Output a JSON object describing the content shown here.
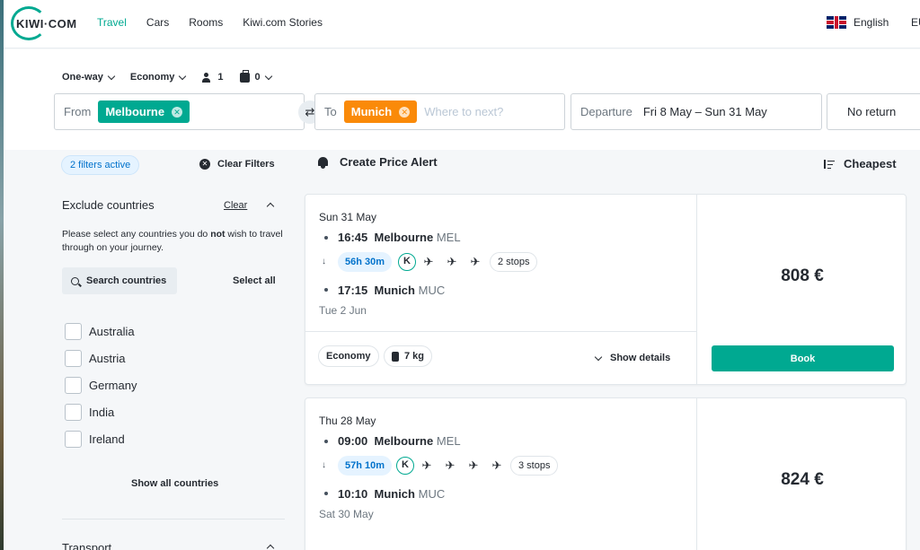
{
  "header": {
    "logo_text": "KIWI·COM",
    "nav": [
      "Travel",
      "Cars",
      "Rooms",
      "Kiwi.com Stories"
    ],
    "language": "English",
    "currency": "EU"
  },
  "search": {
    "trip_type": "One-way",
    "cabin": "Economy",
    "passengers": "1",
    "bags": "0",
    "from_label": "From",
    "from_value": "Melbourne",
    "to_label": "To",
    "to_value": "Munich",
    "to_placeholder": "Where to next?",
    "departure_label": "Departure",
    "departure_value": "Fri 8 May – Sun 31 May",
    "return_value": "No return"
  },
  "filters": {
    "badge": "2 filters active",
    "clear_filters": "Clear Filters",
    "exclude_title": "Exclude countries",
    "clear": "Clear",
    "help_text_before": "Please select any countries you do ",
    "help_text_bold": "not",
    "help_text_after": " wish to travel through on your journey.",
    "search_countries": "Search countries",
    "select_all": "Select all",
    "countries": [
      "Australia",
      "Austria",
      "Germany",
      "India",
      "Ireland"
    ],
    "show_all": "Show all countries",
    "transport": "Transport"
  },
  "results": {
    "create_alert": "Create Price Alert",
    "sort": "Cheapest",
    "cards": [
      {
        "depart_date": "Sun 31 May",
        "depart_time": "16:45",
        "depart_city": "Melbourne",
        "depart_code": "MEL",
        "duration": "56h 30m",
        "stops": "2 stops",
        "planes": 3,
        "arrive_time": "17:15",
        "arrive_city": "Munich",
        "arrive_code": "MUC",
        "arrive_date": "Tue 2 Jun",
        "cabin": "Economy",
        "baggage": "7 kg",
        "show_details": "Show details",
        "price": "808 €",
        "book": "Book"
      },
      {
        "depart_date": "Thu 28 May",
        "depart_time": "09:00",
        "depart_city": "Melbourne",
        "depart_code": "MEL",
        "duration": "57h 10m",
        "stops": "3 stops",
        "planes": 4,
        "arrive_time": "10:10",
        "arrive_city": "Munich",
        "arrive_code": "MUC",
        "arrive_date": "Sat 30 May",
        "price": "824 €"
      }
    ]
  },
  "icons": {
    "plane": "✈",
    "swap": "⇄",
    "close": "✕"
  },
  "colors": {
    "brand": "#00a991",
    "orange": "#fa8a09",
    "blue": "#0172cb"
  }
}
